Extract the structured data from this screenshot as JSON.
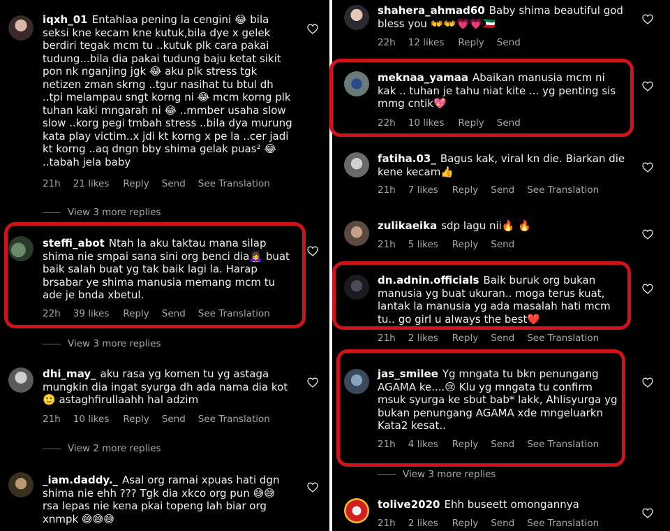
{
  "colors": {
    "background": "#000000",
    "highlight": "#d0121b",
    "meta": "#a8a8a8"
  },
  "left": {
    "c1": {
      "user": "iqxh_01",
      "text": "Entahlaa pening la cengini 😂 bila seksi kne kecam kne kutuk,bila dye x gelek berdiri tegak mcm tu ..kutuk plk cara pakai tudung...bila dia pakai tudung baju ketat sikit pon nk nganjing jgk 😂 aku plk stress tgk netizen zman skrng ..tgur nasihat tu btul dh ..tpi melampau sngt korng ni 😂 mcm korng plk tuhan kaki mngarah ni 😂 ..mmber usaha slow slow ..korg pegi tmbah stress ..bila dya murung kata play victim..x jdi kt korng x pe la ..cer jadi kt korng ..aq dngn bby shima gelak puas² 😂 ..tabah jela baby",
      "time": "21h",
      "likes": "21 likes",
      "reply": "Reply",
      "send": "Send",
      "translate": "See Translation"
    },
    "r1": "View 3 more replies",
    "c2": {
      "user": "steffi_abot",
      "text": "Ntah la aku taktau mana silap shima nie smpai sana sini org benci dia🙇‍♀️ buat baik salah buat yg tak baik lagi la. Harap brsabar ye shima manusia memang mcm tu ade je bnda xbetul.",
      "time": "22h",
      "likes": "39 likes",
      "reply": "Reply",
      "send": "Send",
      "translate": "See Translation"
    },
    "r2": "View 3 more replies",
    "c3": {
      "user": "dhi_may_",
      "text": "aku rasa yg komen tu yg astaga mungkin dia ingat syurga dh ada nama dia kot 🙂 astaghfirullaahh hal adzim",
      "time": "21h",
      "likes": "10 likes",
      "reply": "Reply",
      "send": "Send",
      "translate": "See Translation"
    },
    "r3": "View 2 more replies",
    "c4": {
      "user": "_iam.daddy._",
      "text": "Asal org ramai xpuas hati dgn shima nie ehh ??? Tgk dia xkco org pun 😅😅 rsa lepas nie kena pkai topeng lah biar org xnmpk 😅😅😅"
    }
  },
  "right": {
    "c1": {
      "user": "shahera_ahmad60",
      "text": "Baby shima beautiful god bless you 👐👐💗💗🇰🇼",
      "time": "22h",
      "likes": "12 likes",
      "reply": "Reply",
      "send": "Send"
    },
    "c2": {
      "user": "meknaa_yamaa",
      "text": "Abaikan manusia mcm ni kak .. tuhan je tahu niat kite ... yg penting sis mmg cntik💖",
      "time": "22h",
      "likes": "10 likes",
      "reply": "Reply",
      "send": "Send"
    },
    "c3": {
      "user": "fatiha.03_",
      "text": "Bagus kak, viral kn die. Biarkan die kene kecam👍",
      "time": "21h",
      "likes": "7 likes",
      "reply": "Reply",
      "send": "Send",
      "translate": "See Translation"
    },
    "c4": {
      "user": "zulikaeika",
      "text": "sdp lagu nii🔥 🔥",
      "time": "21h",
      "likes": "5 likes",
      "reply": "Reply",
      "send": "Send"
    },
    "c5": {
      "user": "dn.adnin.officials",
      "text": "Baik buruk org bukan manusia yg buat ukuran.. moga terus kuat, lantak la manusia yg ada masalah hati mcm tu.. go girl u always the best❤️",
      "time": "21h",
      "likes": "2 likes",
      "reply": "Reply",
      "send": "Send",
      "translate": "See Translation"
    },
    "c6": {
      "user": "jas_smilee",
      "text": "Yg mngata tu bkn penungang AGAMA ke....😢 Klu yg mngata tu confirm msuk syurga ke sbut bab* lakk, Ahlisyurga yg bukan penungang  AGAMA xde mngeluarkn Kata2 kesat..",
      "time": "21h",
      "likes": "4 likes",
      "reply": "Reply",
      "send": "Send",
      "translate": "See Translation"
    },
    "r1": "View 3 more replies",
    "c7": {
      "user": "tolive2020",
      "text": "Ehh buseett omongannya",
      "time": "21h",
      "likes": "2 likes",
      "reply": "Reply",
      "send": "Send",
      "translate": "See Translation"
    }
  }
}
